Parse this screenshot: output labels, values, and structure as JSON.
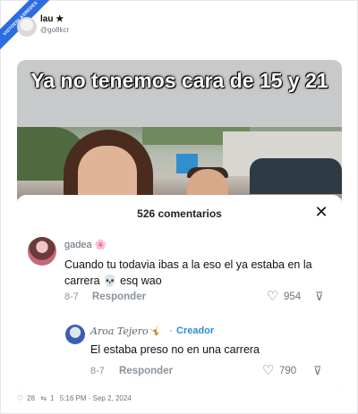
{
  "ribbon": {
    "text": "VISTOENLASREDES"
  },
  "author": {
    "name": "lau ★",
    "handle": "@go8kcr"
  },
  "media": {
    "caption": "Ya no tenemos cara de 15 y 21",
    "sheet": {
      "title": "526 comentarios",
      "close_icon": "close-icon",
      "comments": [
        {
          "user": "gadea 🌸",
          "text": "Cuando tu todavia ibas a la eso el ya estaba en la carrera 💀 esq wao",
          "date": "8-7",
          "reply_label": "Responder",
          "likes": "954"
        },
        {
          "user": "Aroa Tejero🤸",
          "creator_label": "Creador",
          "text": "El estaba preso no en una carrera",
          "date": "8-7",
          "reply_label": "Responder",
          "likes": "790"
        }
      ]
    }
  },
  "footer": {
    "likes": "28",
    "retweets": "1",
    "timestamp": "5:16 PM - Sep 2, 2024"
  }
}
